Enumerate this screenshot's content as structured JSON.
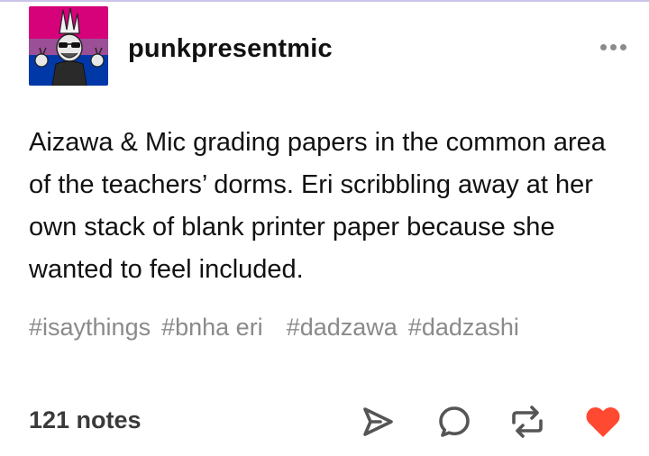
{
  "post": {
    "username": "punkpresentmic",
    "body": "Aizawa & Mic grading papers in the common area of the teachers’ dorms. Eri scribbling away at her own stack of blank printer paper because she wanted to feel included.",
    "tags": [
      "#isaythings",
      "#bnha eri",
      "#dadzawa",
      "#dadzashi"
    ],
    "notes": "121 notes",
    "liked": true
  },
  "icons": {
    "more": "more-horizontal-icon",
    "share": "share-icon",
    "reply": "reply-icon",
    "reblog": "reblog-icon",
    "like": "heart-icon"
  },
  "colors": {
    "avatar_pink": "#d6027a",
    "avatar_purple": "#9b4f96",
    "avatar_blue": "#0038a8",
    "tag_gray": "#8a8a8a",
    "icon_gray": "#555555",
    "like_red": "#ff4930"
  }
}
